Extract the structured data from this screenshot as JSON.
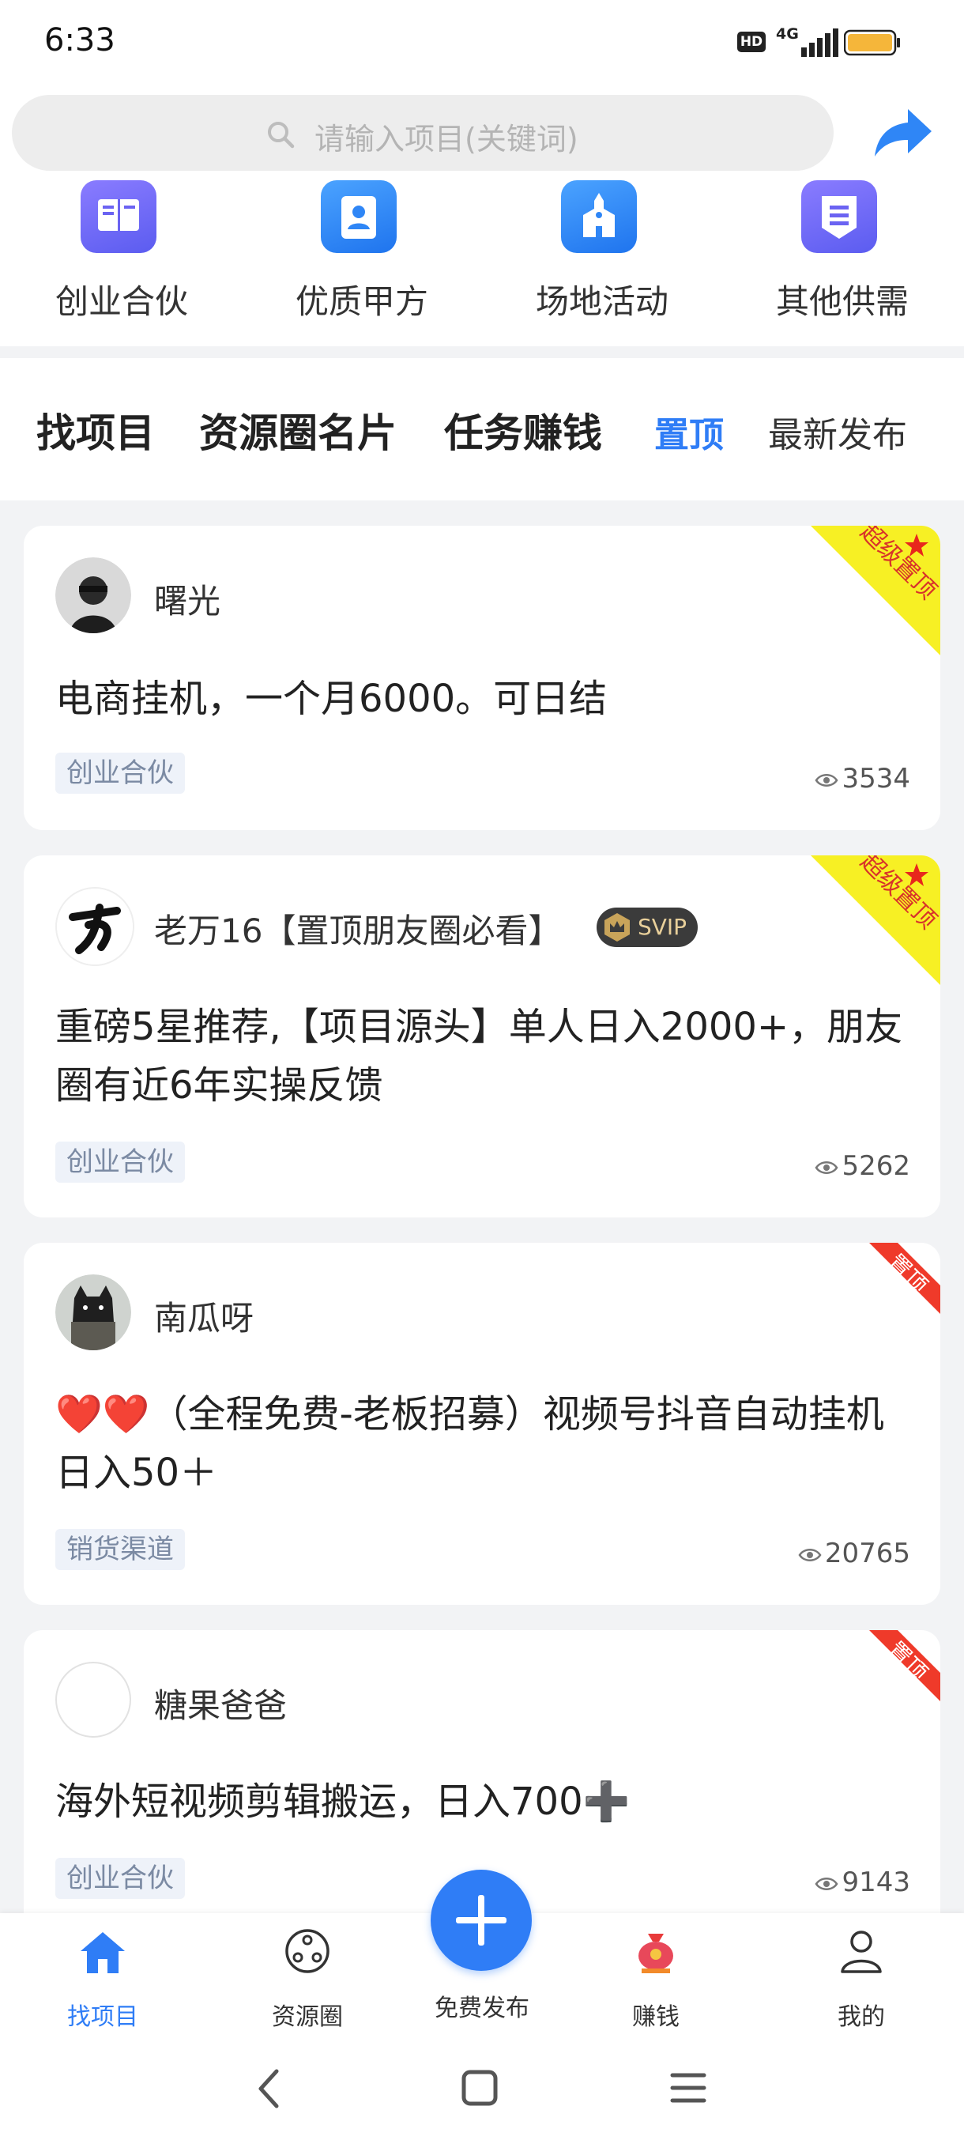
{
  "status_bar": {
    "time": "6:33",
    "hd": "HD",
    "network": "4G"
  },
  "search": {
    "placeholder": "请输入项目(关键词)"
  },
  "categories": [
    {
      "label": "创业合伙",
      "icon": "book-icon",
      "color": "#5b5cf0"
    },
    {
      "label": "优质甲方",
      "icon": "contact-card-icon",
      "color": "#2f86f6"
    },
    {
      "label": "场地活动",
      "icon": "building-icon",
      "color": "#2f86f6"
    },
    {
      "label": "其他供需",
      "icon": "list-badge-icon",
      "color": "#6a5cf0"
    }
  ],
  "tabs": [
    {
      "label": "找项目"
    },
    {
      "label": "资源圈名片"
    },
    {
      "label": "任务赚钱"
    },
    {
      "label": "置顶",
      "active": true
    },
    {
      "label": "最新发布"
    }
  ],
  "posts": [
    {
      "username": "曙光",
      "title": "电商挂机，一个月6000。可日结",
      "tag": "创业合伙",
      "views": "3534",
      "ribbon": "超级置顶"
    },
    {
      "username": "老万16【置顶朋友圈必看】",
      "badge": "SVIP",
      "title": "重磅5星推荐,【项目源头】单人日入2000+，朋友圈有近6年实操反馈",
      "tag": "创业合伙",
      "views": "5262",
      "ribbon": "超级置顶"
    },
    {
      "username": "南瓜呀",
      "title": "❤️❤️（全程免费-老板招募）视频号抖音自动挂机日入50＋",
      "tag": "销货渠道",
      "views": "20765",
      "ribbon": "置顶"
    },
    {
      "username": "糖果爸爸",
      "title": "海外短视频剪辑搬运，日入700➕",
      "tag": "创业合伙",
      "views": "9143",
      "ribbon": "置顶"
    }
  ],
  "bottom_nav": [
    {
      "label": "找项目",
      "icon": "home-icon",
      "active": true
    },
    {
      "label": "资源圈",
      "icon": "circle-network-icon"
    },
    {
      "label": "免费发布",
      "icon": "plus-icon"
    },
    {
      "label": "赚钱",
      "icon": "money-bag-icon"
    },
    {
      "label": "我的",
      "icon": "person-icon"
    }
  ],
  "colors": {
    "accent": "#2f7df6",
    "super_ribbon": "#f7f024",
    "ribbon": "#ef3a2a"
  }
}
